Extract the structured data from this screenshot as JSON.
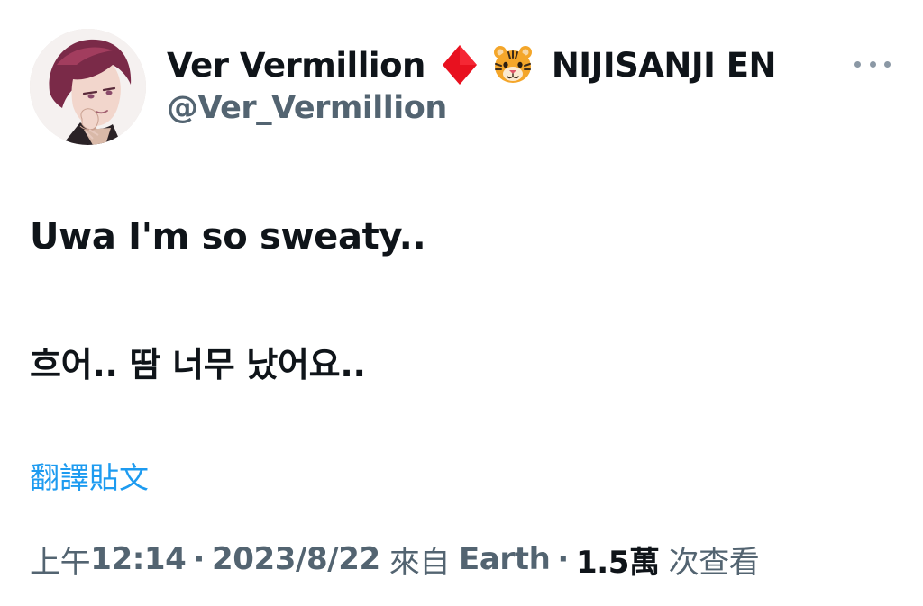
{
  "author": {
    "name_first": "Ver Vermillion",
    "name_second": "NIJISANJI EN",
    "handle": "@Ver_Vermillion",
    "diamond_icon": "red-diamond-emoji",
    "tiger_icon": "tiger-face-emoji",
    "diamond_color": "#e8111f"
  },
  "tweet": {
    "line_1": "Uwa I'm so sweaty..",
    "line_2": "흐어.. 땀 너무 났어요.."
  },
  "translate": {
    "label": "翻譯貼文"
  },
  "meta": {
    "ampm": "上午",
    "time": "12:14",
    "dot_1": "·",
    "date": "2023/8/22",
    "source_prefix": "來自",
    "source": "Earth",
    "dot_2": "·",
    "views_count": "1.5萬",
    "views_label": "次查看"
  },
  "colors": {
    "text": "#0f1419",
    "secondary": "#536471",
    "link": "#1d9bf0"
  }
}
